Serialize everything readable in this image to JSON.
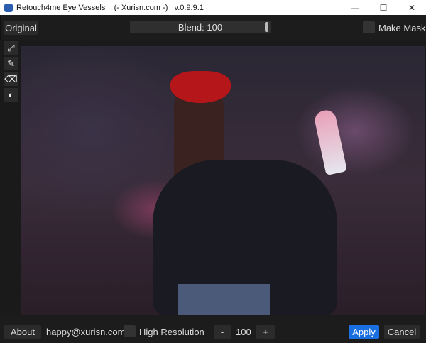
{
  "window": {
    "title": "Retouch4me Eye Vessels    (- Xurisn.com -)   v.0.9.9.1",
    "minimize": "—",
    "maximize": "☐",
    "close": "✕"
  },
  "topbar": {
    "original_label": "Original",
    "blend_label": "Blend: 100",
    "blend_value": 100,
    "make_mask_label": "Make Mask",
    "make_mask_checked": false
  },
  "tools": [
    {
      "icon": "fit-screen-icon",
      "glyph": "⤢"
    },
    {
      "icon": "brush-icon",
      "glyph": "✎"
    },
    {
      "icon": "eraser-icon",
      "glyph": "⌫"
    },
    {
      "icon": "contrast-icon",
      "glyph": "◐"
    }
  ],
  "bottombar": {
    "about_label": "About",
    "email": "happy@xurisn.com",
    "high_res_label": "High Resolution",
    "high_res_checked": false,
    "minus_label": "-",
    "value": "100",
    "plus_label": "+",
    "apply_label": "Apply",
    "cancel_label": "Cancel"
  },
  "colors": {
    "accent": "#1a6fe0",
    "background": "#1c1c1c"
  }
}
